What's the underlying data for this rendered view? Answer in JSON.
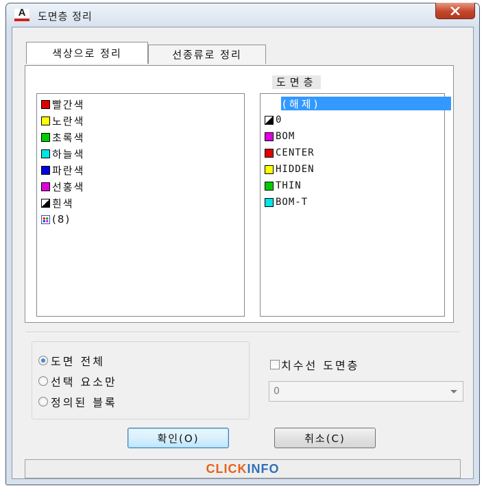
{
  "window": {
    "title": "도면층 정리",
    "app_icon_letter": "A",
    "close_icon": "close-x-icon"
  },
  "tabs": [
    {
      "label": "색상으로 정리",
      "active": true
    },
    {
      "label": "선종류로 정리",
      "active": false
    }
  ],
  "color_list": {
    "items": [
      {
        "label": "빨간색",
        "swatch": "#e00000"
      },
      {
        "label": "노란색",
        "swatch": "#ffff00"
      },
      {
        "label": "초록색",
        "swatch": "#00cc00"
      },
      {
        "label": "하늘색",
        "swatch": "#00e5e5"
      },
      {
        "label": "파란색",
        "swatch": "#0000dd"
      },
      {
        "label": "선홍색",
        "swatch": "#e000e0"
      },
      {
        "label": "흰색",
        "swatch": "black-white-split"
      },
      {
        "label": "(8)",
        "swatch": "multicolor-icon"
      }
    ]
  },
  "layer_list": {
    "header": "도면층",
    "selected": "(해제)",
    "items": [
      {
        "label": "0",
        "swatch": "black-white-split"
      },
      {
        "label": "BOM",
        "swatch": "#e000e0"
      },
      {
        "label": "CENTER",
        "swatch": "#e00000"
      },
      {
        "label": "HIDDEN",
        "swatch": "#ffff00"
      },
      {
        "label": "THIN",
        "swatch": "#00cc00"
      },
      {
        "label": "BOM-T",
        "swatch": "#00e5e5"
      }
    ]
  },
  "scope_options": [
    {
      "label": "도면 전체",
      "checked": true
    },
    {
      "label": "선택 요소만",
      "checked": false
    },
    {
      "label": "정의된 블록",
      "checked": false
    }
  ],
  "dimension_layer": {
    "label": "치수선 도면층",
    "checked": false,
    "combo_value": "0"
  },
  "buttons": {
    "ok": "확인(O)",
    "cancel": "취소(C)"
  },
  "status": {
    "brand_part1": "CLICK",
    "brand_part2": "INFO"
  },
  "colors": {
    "selection": "#3399ff",
    "window_frame": "#d7e1ed",
    "close_button": "#c4472a"
  }
}
